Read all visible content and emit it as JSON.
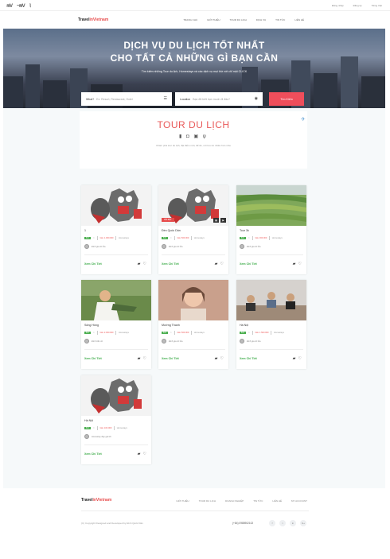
{
  "topbar": {
    "links": [
      "Đăng nhập",
      "Đăng ký",
      "Tiếng Việt"
    ]
  },
  "nav": {
    "brand_main": "Travel",
    "brand_accent": "inVietnam",
    "items": [
      "TRANG CHỦ",
      "GIỚI THIỆU",
      "TOUR DU LỊCH",
      "DỊCH VỤ",
      "TIN TỨC",
      "LIÊN HỆ"
    ]
  },
  "hero": {
    "title_line1": "DỊCH VỤ DU LỊCH TỐT NHẤT",
    "title_line2": "CHO TẤT CẢ NHỮNG GÌ BẠN CẦN",
    "subtitle": "Tìm kiếm những Tour du lịch, Homestays và các dịch vụ mọi thứ với chỉ một CLICK",
    "search": {
      "what_label": "What?",
      "what_placeholder": "Ex: Resort, Restaurant, Hotel",
      "location_label": "Location",
      "location_placeholder": "Bạn đã biết bạn muốn đi đâu?",
      "button": "Tìm Kiếm"
    }
  },
  "tour_section": {
    "title": "TOUR DU LỊCH",
    "description": "Khám phá tour du lịch, địa điểm mới, để ăn, nơi lưu trú nhiều hơn nữa"
  },
  "cards": [
    {
      "title": "1",
      "score": "8.0",
      "price": "Giá: 1.000.000",
      "type": "Homestays",
      "host": "Đinh gia vũ lửa",
      "more": "Xem Chi Tiết",
      "badge": "",
      "image": "cartoon"
    },
    {
      "title": "Đền Quốc Dân",
      "score": "8.0",
      "price": "Giá: 500.000",
      "type": "Homestays",
      "host": "Đinh gia vũ lửa",
      "more": "Xem Chi Tiết",
      "badge": "NỔI BẬT",
      "image": "cartoon"
    },
    {
      "title": "Tour 3k",
      "score": "8.0",
      "price": "Giá: 300.000",
      "type": "Homestays",
      "host": "Đinh gia vũ lửa",
      "more": "Xem Chi Tiết",
      "badge": "",
      "image": "terraces"
    },
    {
      "title": "Sông Hồng",
      "score": "8.0",
      "price": "Giá: 2.000.000",
      "type": "Homestays",
      "host": "Đinh trần vũ",
      "more": "Xem Chi Tiết",
      "badge": "",
      "image": "person-field"
    },
    {
      "title": "Mường Thanh",
      "score": "8.0",
      "price": "Giá: 500.000",
      "type": "Homestays",
      "host": "Đinh gia vũ lửa",
      "more": "Xem Chi Tiết",
      "badge": "",
      "image": "person-portrait"
    },
    {
      "title": "Hà Nội",
      "score": "8.0",
      "price": "Giá: 1.500.000",
      "type": "Homestays",
      "host": "Đinh gia vũ lửa",
      "more": "Xem Chi Tiết",
      "badge": "",
      "image": "group-room"
    },
    {
      "title": "Hà Nội",
      "score": "8.0",
      "price": "Giá: 100.000",
      "type": "Homestays",
      "host": "Homestay đẹp giá tốt",
      "more": "Xem Chi Tiết",
      "badge": "",
      "image": "cartoon"
    }
  ],
  "footer": {
    "brand_main": "Travel",
    "brand_accent": "inVietnam",
    "links": [
      "GIỚI THIỆU",
      "TOUR DU LỊCH",
      "DOANH NGHIỆP",
      "TIN TỨC",
      "LIÊN HỆ",
      "MY ACCOUNT"
    ],
    "copyright": "(C) Copyright Designed and Developed by Đinh Quốc Dân",
    "phone": "(+84) 0985902102",
    "socials": [
      "f",
      "t",
      "in",
      "G+"
    ]
  },
  "colors": {
    "accent": "#e74c4c",
    "green": "#3cab48",
    "bg": "#f6f9fa"
  }
}
